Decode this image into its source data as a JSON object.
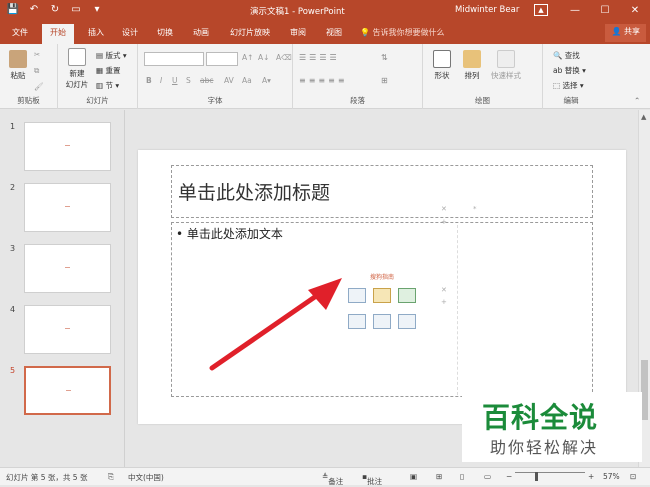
{
  "window": {
    "title": "演示文稿1 - PowerPoint",
    "user": "Midwinter Bear"
  },
  "tabs": [
    "文件",
    "开始",
    "插入",
    "设计",
    "切换",
    "动画",
    "幻灯片放映",
    "审阅",
    "视图"
  ],
  "active_tab": "开始",
  "tell_me": "告诉我你想要做什么",
  "share_label": "共享",
  "ribbon": {
    "clipboard": {
      "paste": "粘贴",
      "label": "剪贴板"
    },
    "slides": {
      "new_slide_line1": "新建",
      "new_slide_line2": "幻灯片",
      "layout": "版式",
      "reset": "重置",
      "section": "节",
      "label": "幻灯片"
    },
    "font": {
      "label": "字体",
      "bold": "B",
      "italic": "I",
      "underline": "U",
      "shadow": "S",
      "strike": "abc"
    },
    "paragraph": {
      "label": "段落"
    },
    "drawing": {
      "shapes": "形状",
      "arrange": "排列",
      "quick_styles": "快速样式",
      "label": "绘图"
    },
    "editing": {
      "find": "查找",
      "replace": "替换",
      "select": "选择",
      "label": "编辑"
    }
  },
  "thumbnails": [
    {
      "number": "1"
    },
    {
      "number": "2"
    },
    {
      "number": "3"
    },
    {
      "number": "4"
    },
    {
      "number": "5"
    }
  ],
  "slide": {
    "title_placeholder": "单击此处添加标题",
    "body_placeholder": "• 单击此处添加文本",
    "mini_caption": "搜狗指南"
  },
  "status": {
    "slide_info": "幻灯片 第 5 张，共 5 张",
    "language": "中文(中国)",
    "notes": "备注",
    "comments": "批注",
    "zoom": "57%"
  },
  "watermark": {
    "line1": "百科全说",
    "line2": "助你轻松解决"
  },
  "colors": {
    "accent": "#b7472a",
    "watermark_green": "#1b8b3a",
    "arrow_red": "#e0202a"
  }
}
